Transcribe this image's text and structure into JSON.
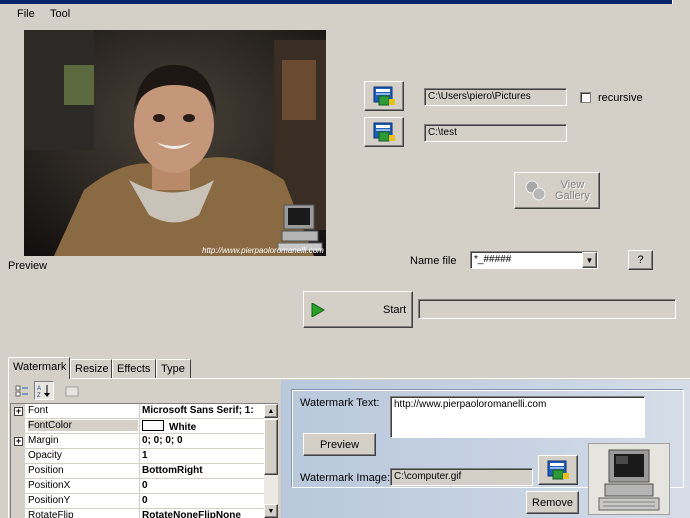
{
  "menu": {
    "file": "File",
    "tool": "Tool"
  },
  "preview": {
    "label": "Preview",
    "caption": "http://www.pierpaoloromanelli.com"
  },
  "folders": {
    "source_path": "C:\\Users\\piero\\Pictures",
    "recursive_label": "recursive",
    "dest_path": "C:\\test"
  },
  "view_gallery": {
    "label_line1": "View",
    "label_line2": "Gallery"
  },
  "name_file": {
    "label": "Name file",
    "value": "*_#####",
    "help_label": "?"
  },
  "start": {
    "label": "Start"
  },
  "tabs": {
    "watermark": "Watermark",
    "resize": "Resize",
    "effects": "Effects",
    "type": "Type"
  },
  "properties": [
    {
      "name": "Font",
      "value": "Microsoft Sans Serif; 1:",
      "expandable": true
    },
    {
      "name": "FontColor",
      "value": "White",
      "swatch": "#ffffff"
    },
    {
      "name": "Margin",
      "value": "0; 0; 0; 0",
      "expandable": true
    },
    {
      "name": "Opacity",
      "value": "1"
    },
    {
      "name": "Position",
      "value": "BottomRight"
    },
    {
      "name": "PositionX",
      "value": "0"
    },
    {
      "name": "PositionY",
      "value": "0"
    },
    {
      "name": "RotateFlip",
      "value": "RotateNoneFlipNone"
    }
  ],
  "watermark": {
    "text_label": "Watermark Text:",
    "text_value": "http://www.pierpaoloromanelli.com",
    "preview_label": "Preview",
    "image_label": "Watermark Image:",
    "image_value": "C:\\computer.gif",
    "remove_label": "Remove"
  },
  "colors": {
    "title_bar": "#0a246a",
    "face": "#d4d0c8",
    "panel_blue": "#c7d3e3",
    "start_arrow": "#2aa02a"
  },
  "icons": [
    "folder-browse-icon",
    "view-gallery-icon",
    "play-icon",
    "categorized-sort-icon",
    "alphabetical-sort-icon",
    "property-pages-icon",
    "computer-icon"
  ]
}
